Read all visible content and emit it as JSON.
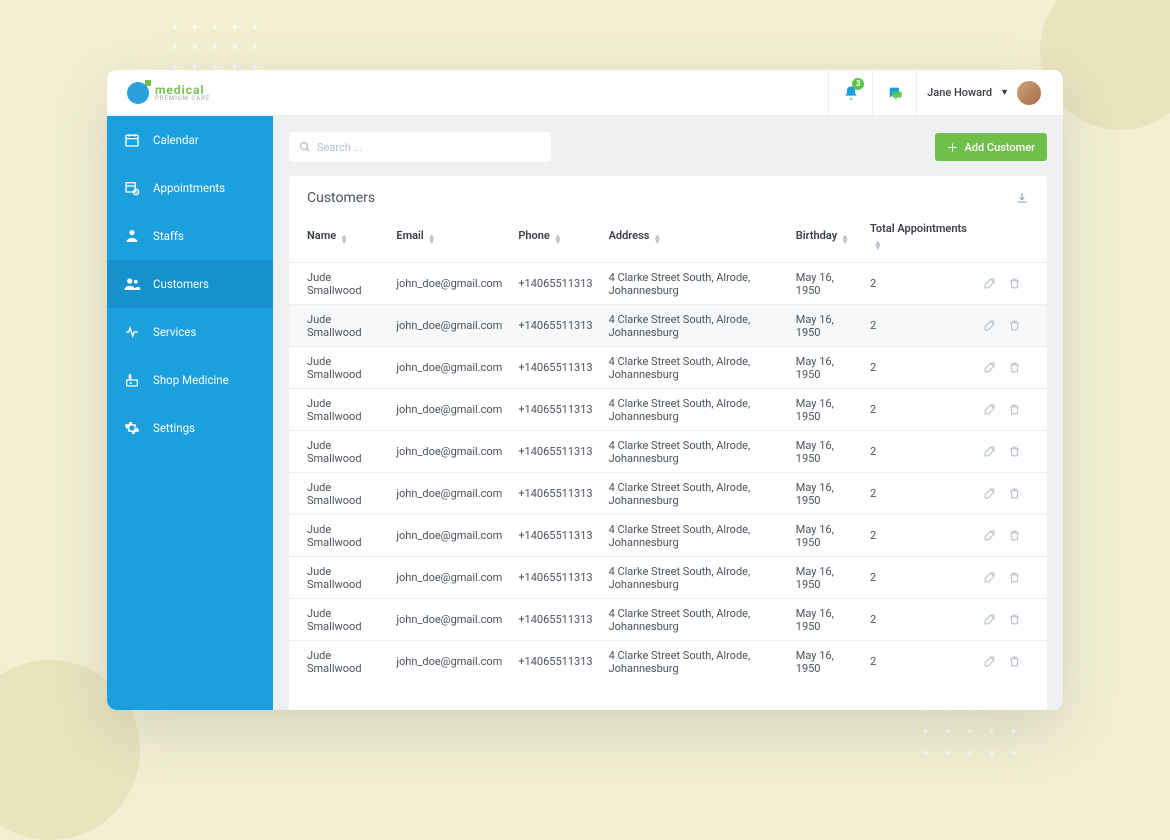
{
  "brand": {
    "name": "medical",
    "sub": "PREMIUM CARE"
  },
  "topbar": {
    "notification_count": "3",
    "user_name": "Jane Howard"
  },
  "sidebar": {
    "items": [
      {
        "label": "Calendar",
        "icon": "calendar-icon"
      },
      {
        "label": "Appointments",
        "icon": "appointments-icon"
      },
      {
        "label": "Staffs",
        "icon": "staffs-icon"
      },
      {
        "label": "Customers",
        "icon": "customers-icon",
        "active": true
      },
      {
        "label": "Services",
        "icon": "services-icon"
      },
      {
        "label": "Shop Medicine",
        "icon": "shop-icon"
      },
      {
        "label": "Settings",
        "icon": "settings-icon"
      }
    ]
  },
  "search": {
    "placeholder": "Search ..."
  },
  "add_button": "Add Customer",
  "card": {
    "title": "Customers"
  },
  "columns": {
    "name": "Name",
    "email": "Email",
    "phone": "Phone",
    "address": "Address",
    "birthday": "Birthday",
    "total": "Total Appointments"
  },
  "rows": [
    {
      "name": "Jude Smallwood",
      "email": "john_doe@gmail.com",
      "phone": "+14065511313",
      "address": "4 Clarke Street South, Alrode, Johannesburg",
      "birthday": "May 16, 1950",
      "total": "2"
    },
    {
      "name": "Jude Smallwood",
      "email": "john_doe@gmail.com",
      "phone": "+14065511313",
      "address": "4 Clarke Street South, Alrode, Johannesburg",
      "birthday": "May 16, 1950",
      "total": "2"
    },
    {
      "name": "Jude Smallwood",
      "email": "john_doe@gmail.com",
      "phone": "+14065511313",
      "address": "4 Clarke Street South, Alrode, Johannesburg",
      "birthday": "May 16, 1950",
      "total": "2"
    },
    {
      "name": "Jude Smallwood",
      "email": "john_doe@gmail.com",
      "phone": "+14065511313",
      "address": "4 Clarke Street South, Alrode, Johannesburg",
      "birthday": "May 16, 1950",
      "total": "2"
    },
    {
      "name": "Jude Smallwood",
      "email": "john_doe@gmail.com",
      "phone": "+14065511313",
      "address": "4 Clarke Street South, Alrode, Johannesburg",
      "birthday": "May 16, 1950",
      "total": "2"
    },
    {
      "name": "Jude Smallwood",
      "email": "john_doe@gmail.com",
      "phone": "+14065511313",
      "address": "4 Clarke Street South, Alrode, Johannesburg",
      "birthday": "May 16, 1950",
      "total": "2"
    },
    {
      "name": "Jude Smallwood",
      "email": "john_doe@gmail.com",
      "phone": "+14065511313",
      "address": "4 Clarke Street South, Alrode, Johannesburg",
      "birthday": "May 16, 1950",
      "total": "2"
    },
    {
      "name": "Jude Smallwood",
      "email": "john_doe@gmail.com",
      "phone": "+14065511313",
      "address": "4 Clarke Street South, Alrode, Johannesburg",
      "birthday": "May 16, 1950",
      "total": "2"
    },
    {
      "name": "Jude Smallwood",
      "email": "john_doe@gmail.com",
      "phone": "+14065511313",
      "address": "4 Clarke Street South, Alrode, Johannesburg",
      "birthday": "May 16, 1950",
      "total": "2"
    },
    {
      "name": "Jude Smallwood",
      "email": "john_doe@gmail.com",
      "phone": "+14065511313",
      "address": "4 Clarke Street South, Alrode, Johannesburg",
      "birthday": "May 16, 1950",
      "total": "2"
    }
  ]
}
